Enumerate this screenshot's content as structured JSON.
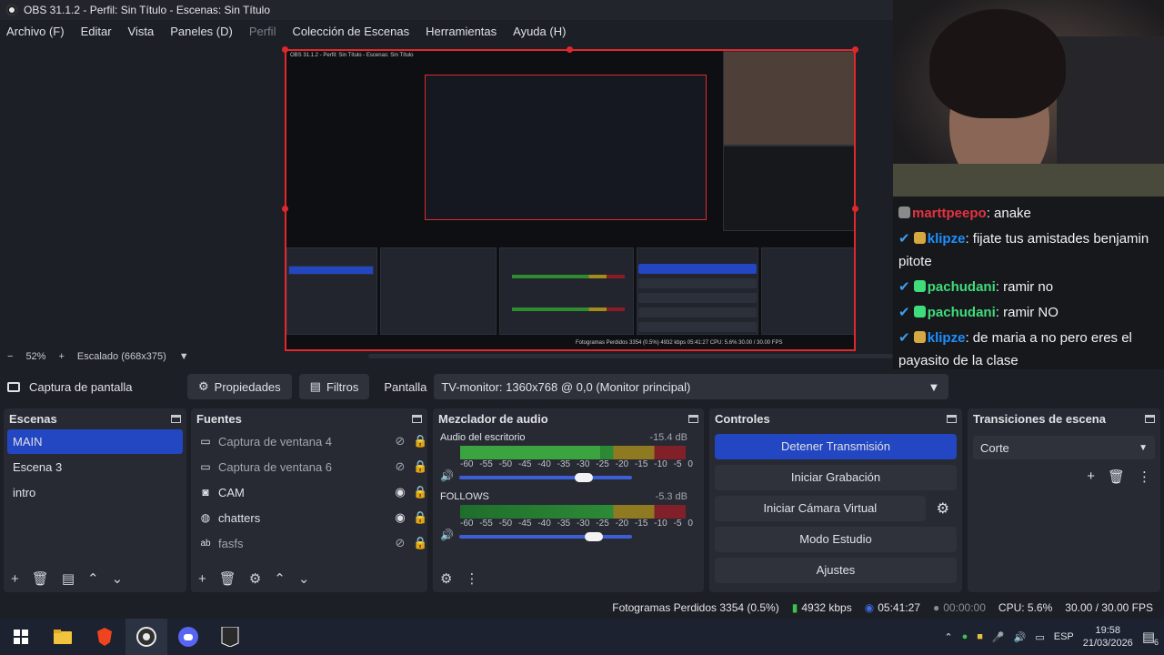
{
  "window": {
    "title": "OBS 31.1.2 - Perfil: Sin Título - Escenas: Sin Título"
  },
  "menu": {
    "archivo": "Archivo (F)",
    "editar": "Editar",
    "vista": "Vista",
    "paneles": "Paneles (D)",
    "perfil": "Perfil",
    "coleccion": "Colección de Escenas",
    "herramientas": "Herramientas",
    "ayuda": "Ayuda (H)"
  },
  "preview": {
    "zoom": "52%",
    "scaling": "Escalado (668x375)",
    "nested_title": "OBS 31.1.2 - Perfil: Sin Título - Escenas: Sin Título",
    "nested_status": "Fotogramas Perdidos 3354 (0.5%)   4932 kbps   05:41:27   CPU: 5.6%   30.00 / 30.00 FPS"
  },
  "chat": {
    "messages": [
      {
        "user": "marttpeepo",
        "text": ": anake"
      },
      {
        "user": "klipze",
        "text": ": fijate tus amistades benjamin pitote"
      },
      {
        "user": "pachudani",
        "text": ": ramir no"
      },
      {
        "user": "pachudani",
        "text": ": ramir NO"
      },
      {
        "user": "klipze",
        "text": ": de maria a no pero eres el payasito de la clase"
      }
    ]
  },
  "sourcebar": {
    "source_name": "Captura de pantalla",
    "properties": "Propiedades",
    "filters": "Filtros",
    "display_label": "Pantalla",
    "display_value": "TV-monitor: 1360x768 @ 0,0 (Monitor principal)"
  },
  "scenes": {
    "title": "Escenas",
    "items": [
      "MAIN",
      "Escena 3",
      "intro"
    ]
  },
  "sources": {
    "title": "Fuentes",
    "items": [
      {
        "name": "Captura de ventana 4",
        "icon": "window-icon",
        "visible": false
      },
      {
        "name": "Captura de ventana 6",
        "icon": "window-icon",
        "visible": false
      },
      {
        "name": "CAM",
        "icon": "camera-icon",
        "visible": true
      },
      {
        "name": "chatters",
        "icon": "globe-icon",
        "visible": true
      },
      {
        "name": "fasfs",
        "icon": "text-icon",
        "visible": false
      }
    ]
  },
  "mixer": {
    "title": "Mezclador de audio",
    "ticks": [
      "-60",
      "-55",
      "-50",
      "-45",
      "-40",
      "-35",
      "-30",
      "-25",
      "-20",
      "-15",
      "-10",
      "-5",
      "0"
    ],
    "tracks": [
      {
        "name": "Audio del escritorio",
        "db": "-15.4 dB",
        "level": 0.62,
        "volume": 0.72
      },
      {
        "name": "FOLLOWS",
        "db": "-5.3 dB",
        "level": 0.0,
        "volume": 0.78
      }
    ]
  },
  "controls": {
    "title": "Controles",
    "stop_stream": "Detener Transmisión",
    "start_recording": "Iniciar Grabación",
    "start_virtualcam": "Iniciar Cámara Virtual",
    "studio_mode": "Modo Estudio",
    "settings": "Ajustes"
  },
  "transitions": {
    "title": "Transiciones de escena",
    "selected": "Corte"
  },
  "status": {
    "dropped": "Fotogramas Perdidos 3354 (0.5%)",
    "bitrate": "4932 kbps",
    "stream_time": "05:41:27",
    "rec_time": "00:00:00",
    "cpu": "CPU: 5.6%",
    "fps": "30.00 / 30.00 FPS"
  },
  "taskbar": {
    "lang": "ESP",
    "time": "19:58",
    "date": "21/03/2026",
    "notifications": "6"
  },
  "colors": {
    "accent": "#2346c2",
    "recording_border": "#e0282c"
  }
}
